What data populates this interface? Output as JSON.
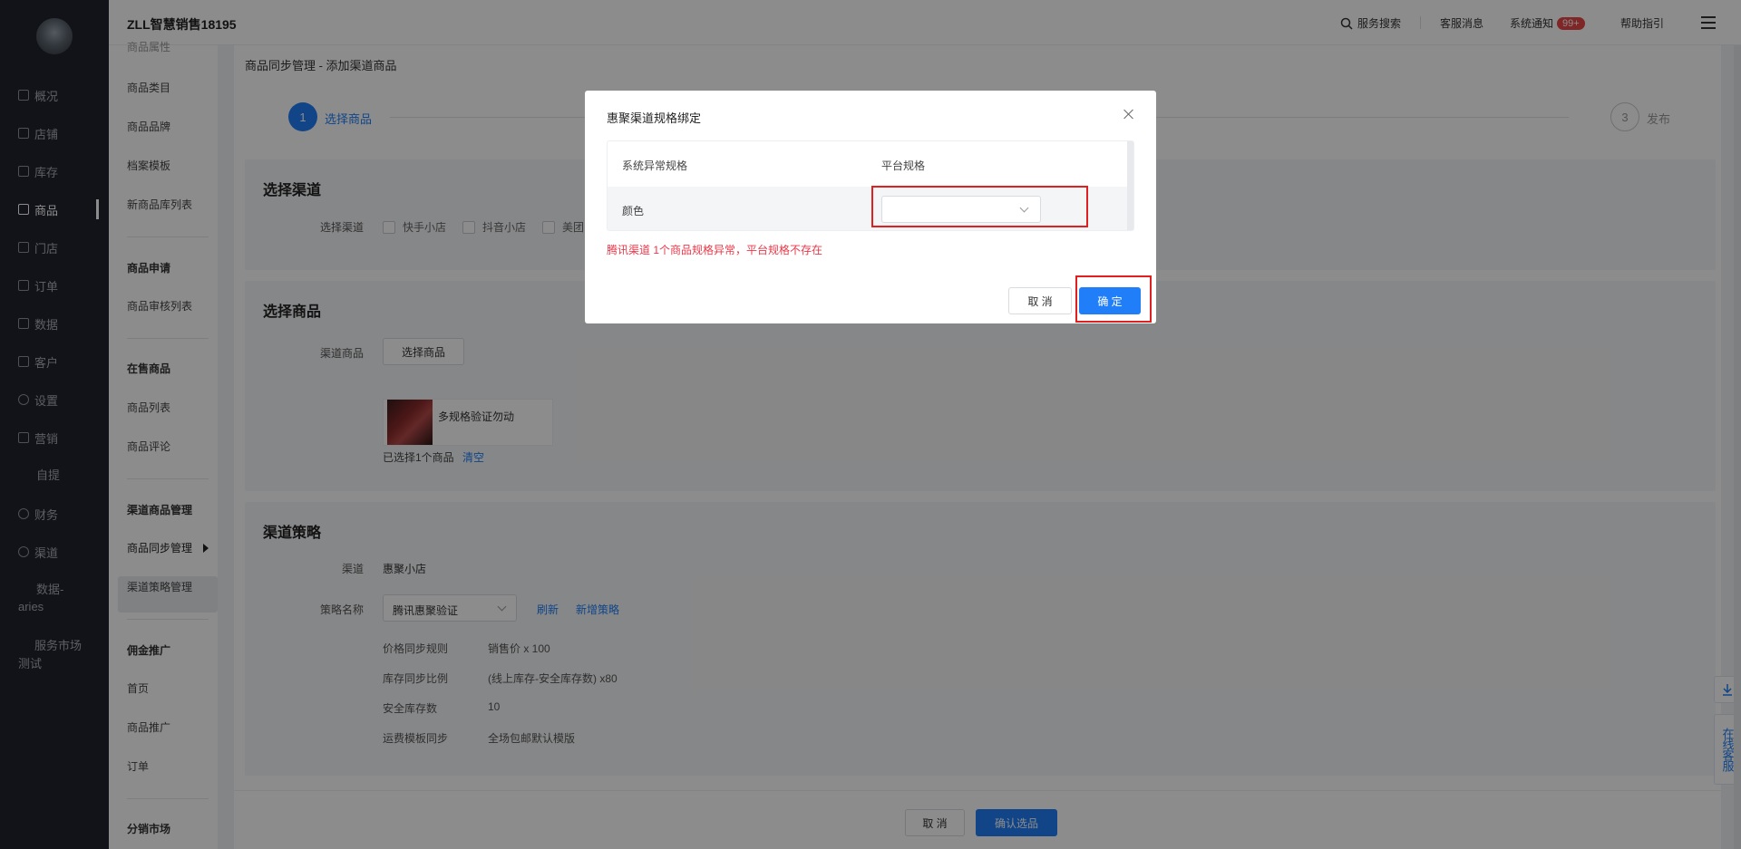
{
  "app": {
    "brand": "ZLL智慧销售18195"
  },
  "topbar": {
    "search": "服务搜索",
    "service_msg": "客服消息",
    "system_notice": "系统通知",
    "notice_badge": "99+",
    "help": "帮助指引"
  },
  "leftnav": {
    "items": [
      "概况",
      "店铺",
      "库存",
      "商品",
      "门店",
      "订单",
      "数据",
      "客户",
      "设置",
      "营销"
    ],
    "ziti": "自提",
    "finance": "财务",
    "channel": "渠道",
    "data_aries_1": "数据-",
    "data_aries_2": "aries",
    "market_1": "服务市场",
    "market_2": "测试"
  },
  "subnav": {
    "cut_top": "商品属性",
    "goods_category": "商品类目",
    "goods_brand": "商品品牌",
    "archive_template": "档案模板",
    "new_goods_library": "新商品库列表",
    "goods_apply": "商品申请",
    "goods_audit": "商品审核列表",
    "on_sale": "在售商品",
    "goods_list": "商品列表",
    "goods_review": "商品评论",
    "channel_goods_mgmt": "渠道商品管理",
    "goods_sync_mgmt": "商品同步管理",
    "channel_policy_mgmt": "渠道策略管理",
    "commission": "佣金推广",
    "home": "首页",
    "goods_promo": "商品推广",
    "order": "订单",
    "distribution": "分销市场"
  },
  "page": {
    "breadcrumb": "商品同步管理 - 添加渠道商品",
    "step1_num": "1",
    "step1_label": "选择商品",
    "step3_num": "3",
    "step3_label": "发布"
  },
  "section_channel": {
    "title": "选择渠道",
    "label": "选择渠道",
    "options": [
      "快手小店",
      "抖音小店",
      "美团"
    ]
  },
  "section_goods": {
    "title": "选择商品",
    "label": "渠道商品",
    "select_btn": "选择商品",
    "product_name": "多规格验证勿动",
    "selected_count": "已选择1个商品",
    "clear": "清空"
  },
  "section_policy": {
    "title": "渠道策略",
    "channel_label": "渠道",
    "channel_value": "惠聚小店",
    "policy_label": "策略名称",
    "policy_value": "腾讯惠聚验证",
    "refresh": "刷新",
    "add_policy": "新增策略",
    "rules": [
      {
        "k": "价格同步规则",
        "v": "销售价 x 100"
      },
      {
        "k": "库存同步比例",
        "v": "(线上库存-安全库存数) x80"
      },
      {
        "k": "安全库存数",
        "v": "10"
      },
      {
        "k": "运费模板同步",
        "v": "全场包邮默认模版"
      }
    ]
  },
  "footer": {
    "cancel": "取 消",
    "confirm": "确认选品"
  },
  "modal": {
    "title": "惠聚渠道规格绑定",
    "col1": "系统异常规格",
    "col2": "平台规格",
    "row_spec": "颜色",
    "select_placeholder": "",
    "error": "腾讯渠道 1个商品规格异常，平台规格不存在",
    "cancel": "取 消",
    "ok": "确 定"
  },
  "float": {
    "online_service": "在线客服"
  }
}
